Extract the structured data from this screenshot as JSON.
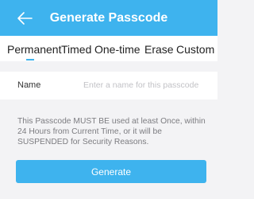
{
  "header": {
    "title": "Generate Passcode",
    "back_icon": "arrow-left-icon",
    "color": "#3eb3ee"
  },
  "tabs": [
    {
      "label": "Permanent",
      "active": true
    },
    {
      "label": "Timed",
      "active": false
    },
    {
      "label": "One-time",
      "active": false
    },
    {
      "label": "Erase",
      "active": false
    },
    {
      "label": "Custom",
      "active": false
    }
  ],
  "form": {
    "name_label": "Name",
    "name_placeholder": "Enter a name for this passcode",
    "name_value": ""
  },
  "notice": "This Passcode MUST BE used at least Once, within 24 Hours from Current Time, or it will be SUSPENDED for Security Reasons.",
  "generate_button": "Generate"
}
